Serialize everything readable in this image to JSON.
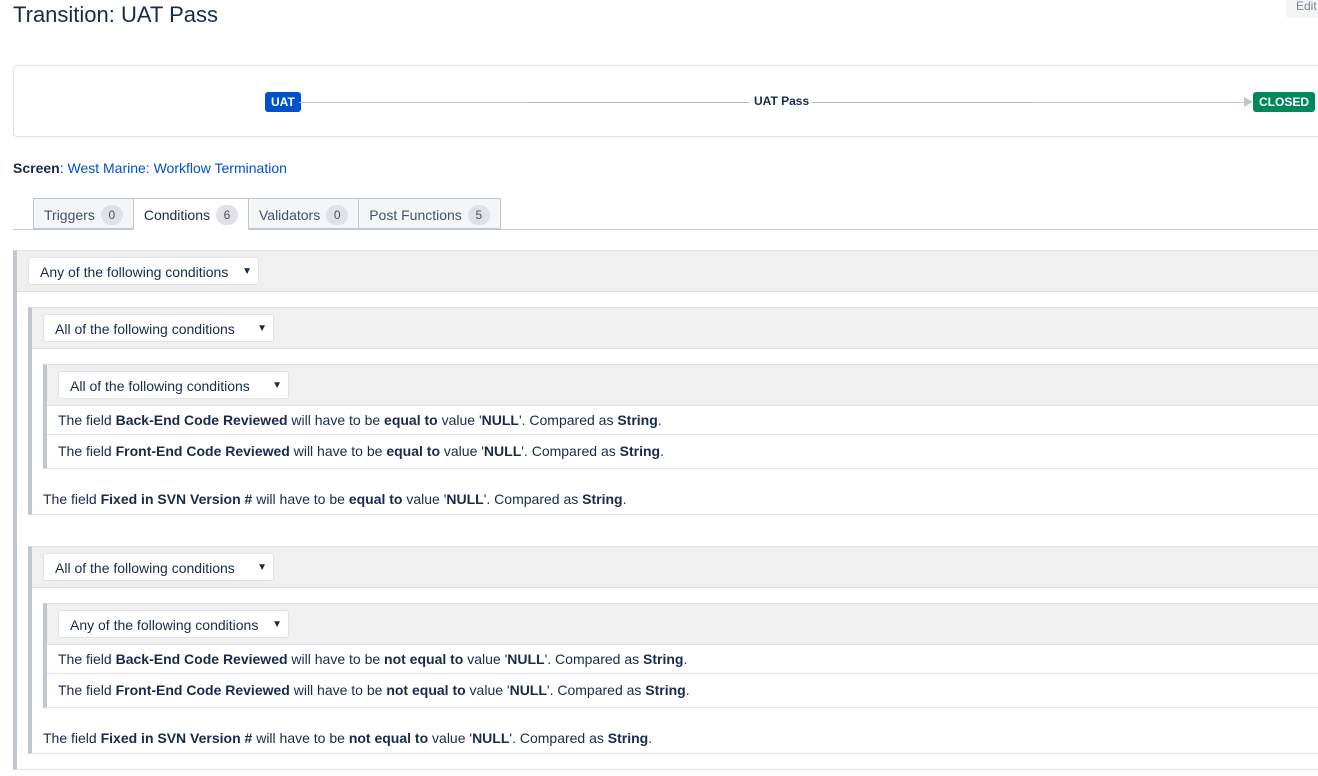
{
  "page": {
    "title": "Transition: UAT Pass",
    "edit_label": "Edit"
  },
  "diagram": {
    "from_status": "UAT",
    "transition": "UAT Pass",
    "to_status": "CLOSED",
    "colors": {
      "from": "#0052cc",
      "to": "#00875a"
    }
  },
  "screen": {
    "label": "Screen",
    "value": "West Marine: Workflow Termination"
  },
  "tabs": [
    {
      "label": "Triggers",
      "count": "0"
    },
    {
      "label": "Conditions",
      "count": "6",
      "active": true
    },
    {
      "label": "Validators",
      "count": "0"
    },
    {
      "label": "Post Functions",
      "count": "5"
    }
  ],
  "conditions": {
    "root_operator": "Any of the following conditions",
    "group1": {
      "operator": "All of the following conditions",
      "subgroup": {
        "operator": "All of the following conditions",
        "rows": [
          {
            "prefix": "The field ",
            "field": "Back-End Code Reviewed",
            "mid": " will have to be ",
            "comparison": "equal to",
            "value_prefix": " value '",
            "value": "NULL",
            "compared": "'. Compared as ",
            "type": "String",
            "end": "."
          },
          {
            "prefix": "The field ",
            "field": "Front-End Code Reviewed",
            "mid": " will have to be ",
            "comparison": "equal to",
            "value_prefix": " value '",
            "value": "NULL",
            "compared": "'. Compared as ",
            "type": "String",
            "end": "."
          }
        ]
      },
      "row": {
        "prefix": "The field ",
        "field": "Fixed in SVN Version #",
        "mid": " will have to be ",
        "comparison": "equal to",
        "value_prefix": " value '",
        "value": "NULL",
        "compared": "'. Compared as ",
        "type": "String",
        "end": "."
      }
    },
    "group2": {
      "operator": "All of the following conditions",
      "subgroup": {
        "operator": "Any of the following conditions",
        "rows": [
          {
            "prefix": "The field ",
            "field": "Back-End Code Reviewed",
            "mid": " will have to be ",
            "comparison": "not equal to",
            "value_prefix": " value '",
            "value": "NULL",
            "compared": "'. Compared as ",
            "type": "String",
            "end": "."
          },
          {
            "prefix": "The field ",
            "field": "Front-End Code Reviewed",
            "mid": " will have to be ",
            "comparison": "not equal to",
            "value_prefix": " value '",
            "value": "NULL",
            "compared": "'. Compared as ",
            "type": "String",
            "end": "."
          }
        ]
      },
      "row": {
        "prefix": "The field ",
        "field": "Fixed in SVN Version #",
        "mid": " will have to be ",
        "comparison": "not equal to",
        "value_prefix": " value '",
        "value": "NULL",
        "compared": "'. Compared as ",
        "type": "String",
        "end": "."
      }
    }
  }
}
